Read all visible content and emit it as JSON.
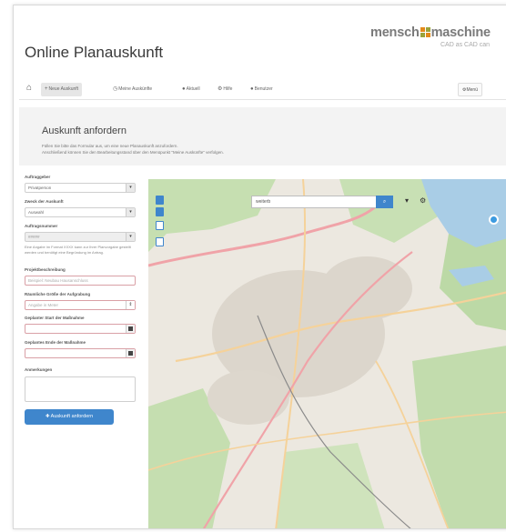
{
  "header": {
    "app_title": "Online Planauskunft",
    "logo_left": "mensch",
    "logo_right": "maschine",
    "tagline": "CAD as CAD can"
  },
  "nav": {
    "home_icon": "home-icon",
    "items": [
      {
        "icon": "plus-icon",
        "label": "Neue Auskunft",
        "active": true
      },
      {
        "icon": "clock-icon",
        "label": "Meine Auskünfte",
        "active": false
      },
      {
        "icon": "user-icon",
        "label": "Aktuell",
        "active": false
      },
      {
        "icon": "gear-icon",
        "label": "Hilfe",
        "active": false
      },
      {
        "icon": "user-icon",
        "label": "Benutzer",
        "active": false
      }
    ],
    "menu_label": "Menü"
  },
  "info": {
    "title": "Auskunft anfordern",
    "line1": "Füllen Sie bitte das Formular aus, um eine neue Planauskunft anzufordern.",
    "line2": "Anschließend können Sie den Bearbeitungsstand über den Menüpunkt \"Meine Auskünfte\" verfolgen."
  },
  "form": {
    "lbl_type": "Auftraggeber",
    "val_type": "Privatperson",
    "lbl_purpose": "Zweck der Auskunft",
    "val_purpose": "Auswahl",
    "lbl_number": "Auftragsnummer",
    "val_number": "#####",
    "help_number": "Eine Angabe im Format XXXX kann zur Ihrer Planvorgabe gestellt werden und benötigt eine Begründung im Antrag.",
    "lbl_desc": "Projektbeschreibung",
    "ph_desc": "Beispiel: Neubau Hausanschluss",
    "lbl_area": "Räumliche Größe der Aufgrabung",
    "ph_area": "Angabe in Meter",
    "lbl_start": "Geplanter Start der Maßnahme",
    "lbl_end": "Geplantes Ende der Maßnahme",
    "lbl_notes": "Anmerkungen",
    "submit_label": "Auskunft anfordern"
  },
  "map": {
    "search_value": "weiterb",
    "search_icon": "search-icon",
    "colors": {
      "water": "#a9cde6",
      "forest": "#b7d8a2",
      "urban": "#dcd6cc",
      "road_primary": "#f0a3a8",
      "road_secondary": "#f5d29a"
    }
  }
}
